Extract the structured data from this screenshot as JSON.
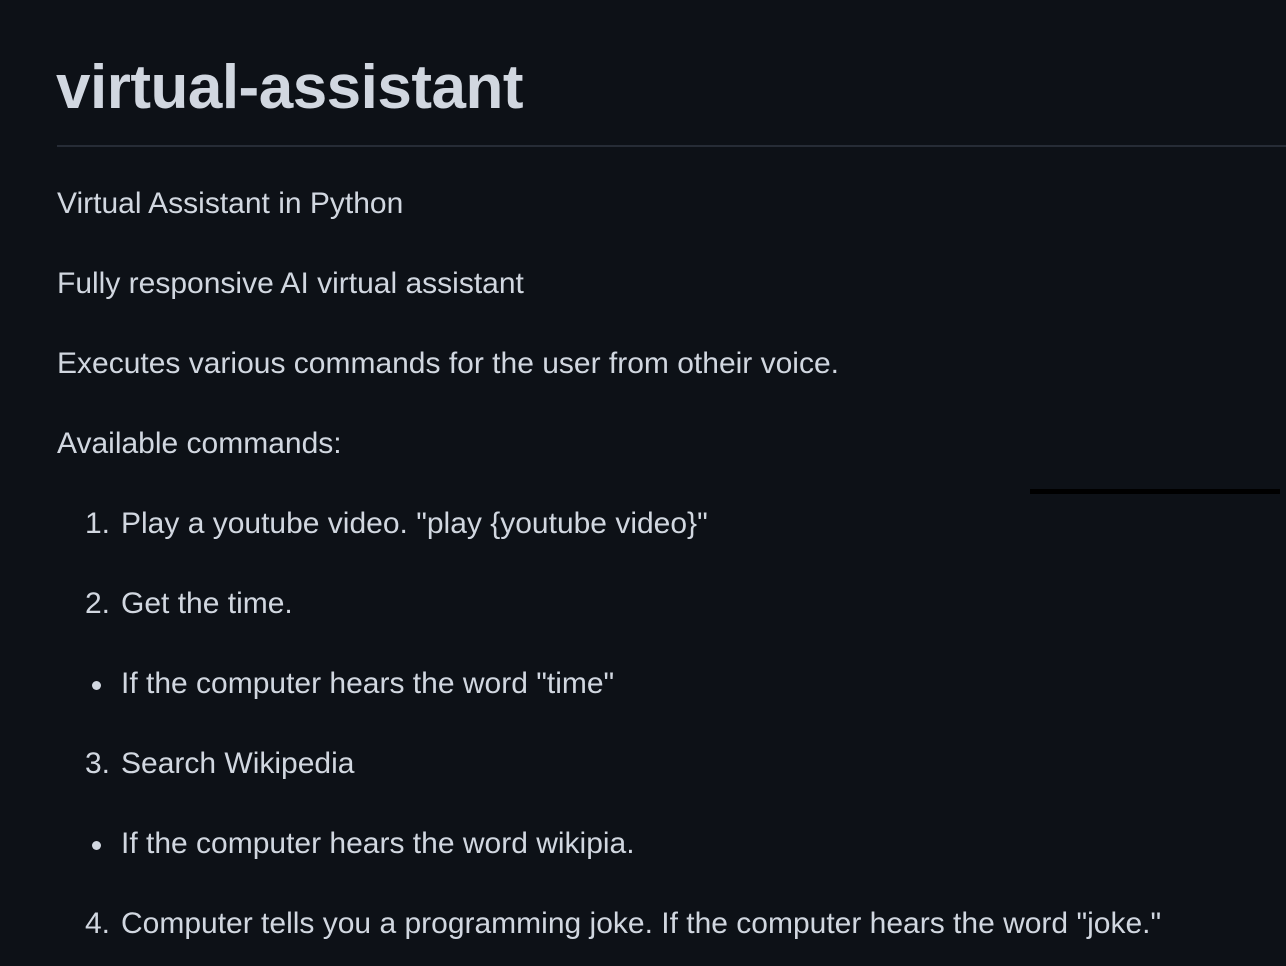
{
  "title": "virtual-assistant",
  "paragraphs": [
    "Virtual Assistant in Python",
    "Fully responsive AI virtual assistant",
    "Executes various commands for the user from otheir voice.",
    "Available commands:"
  ],
  "items": [
    {
      "num": "1.",
      "text": "Play a youtube video. \"play {youtube video}\""
    },
    {
      "num": "2.",
      "text": "Get the time."
    },
    {
      "bullet": "If the computer hears the word \"time\""
    },
    {
      "num": "3.",
      "text": "Search Wikipedia"
    },
    {
      "bullet": "If the computer hears the word wikipia."
    },
    {
      "num": "4.",
      "text": "Computer tells you a programming joke. If the computer hears the word \"joke.\""
    }
  ]
}
